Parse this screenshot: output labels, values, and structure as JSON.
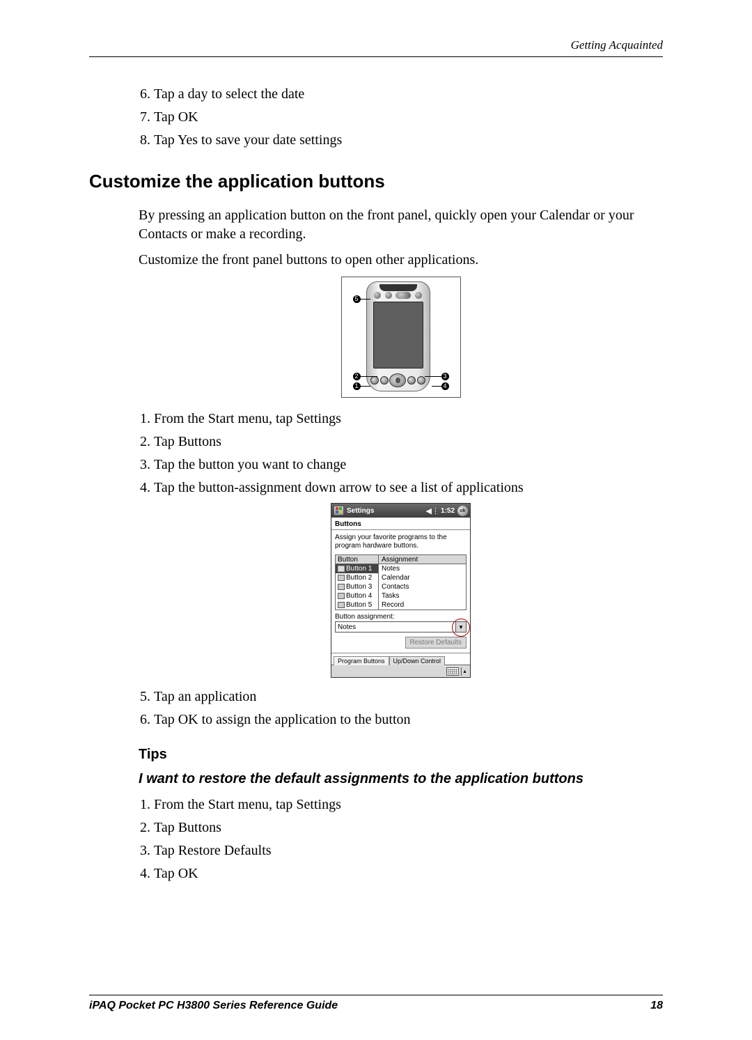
{
  "header": {
    "right_text": "Getting Acquainted"
  },
  "steps_top": [
    "Tap a day to select the date",
    "Tap OK",
    "Tap Yes to save your date settings"
  ],
  "steps_top_start": 6,
  "section_heading": "Customize the application buttons",
  "para1": "By pressing an application button on the front panel, quickly open your Calendar or your Contacts or make a recording.",
  "para2": "Customize the front panel buttons to open other applications.",
  "device_callouts": {
    "c1": "1",
    "c2": "2",
    "c3": "3",
    "c4": "4",
    "c5": "5"
  },
  "steps_mid_a": [
    "From the Start menu, tap Settings",
    "Tap Buttons",
    "Tap the button you want to change",
    "Tap the button-assignment down arrow to see a list of applications"
  ],
  "steps_mid_a_start": 1,
  "ppc": {
    "title": "Settings",
    "time": "1:52",
    "ok": "ok",
    "section_label": "Buttons",
    "instruction": "Assign your favorite programs to the program hardware buttons.",
    "col_button": "Button",
    "col_assignment": "Assignment",
    "rows": [
      {
        "button": "Button 1",
        "assignment": "Notes"
      },
      {
        "button": "Button 2",
        "assignment": "Calendar"
      },
      {
        "button": "Button 3",
        "assignment": "Contacts"
      },
      {
        "button": "Button 4",
        "assignment": "Tasks"
      },
      {
        "button": "Button 5",
        "assignment": "Record"
      }
    ],
    "assign_label": "Button assignment:",
    "dropdown_value": "Notes",
    "restore_btn": "Restore Defaults",
    "tab1": "Program Buttons",
    "tab2": "Up/Down Control"
  },
  "steps_mid_b": [
    "Tap an application",
    "Tap OK to assign the application to the button"
  ],
  "steps_mid_b_start": 5,
  "tips_heading": "Tips",
  "tip_title": "I want to restore the default assignments to the application buttons",
  "steps_tips": [
    "From the Start menu, tap Settings",
    "Tap Buttons",
    "Tap Restore Defaults",
    "Tap OK"
  ],
  "steps_tips_start": 1,
  "footer": {
    "left": "iPAQ Pocket PC H3800 Series Reference Guide",
    "right": "18"
  }
}
